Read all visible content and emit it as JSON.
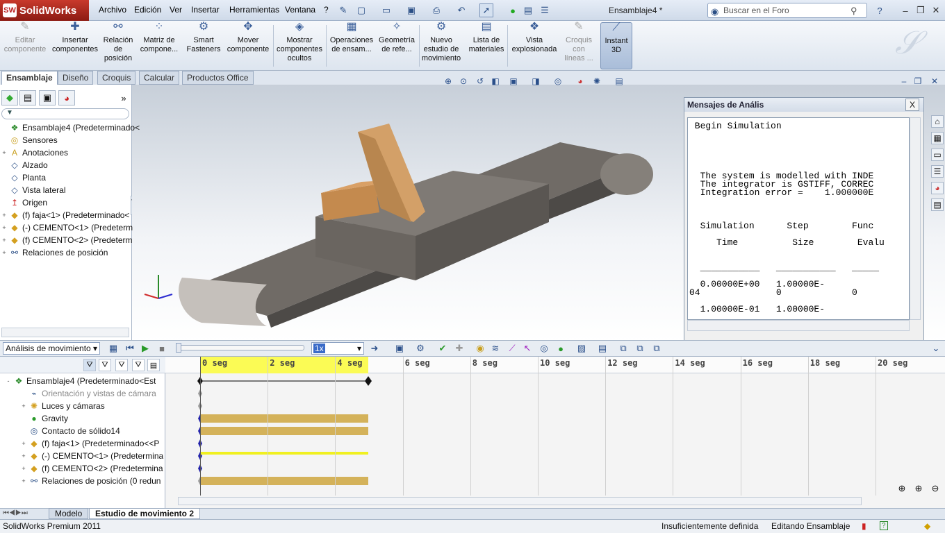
{
  "app": {
    "name": "SolidWorks",
    "doc_title": "Ensamblaje4 *"
  },
  "menu": [
    "Archivo",
    "Edición",
    "Ver",
    "Insertar",
    "Herramientas",
    "Ventana",
    "?"
  ],
  "search": {
    "placeholder": "Buscar en el Foro"
  },
  "ribbon": {
    "edit_component": "Editar componente",
    "insert_components": "Insertar componentes",
    "mate": "Relación de posición",
    "pattern": "Matriz de compone...",
    "smart_fasteners": "Smart Fasteners",
    "move_component": "Mover componente",
    "show_hidden": "Mostrar componentes ocultos",
    "assembly_features": "Operaciones de ensam...",
    "ref_geometry": "Geometría de refe...",
    "new_motion_study": "Nuevo estudio de movimiento",
    "bom": "Lista de materiales",
    "exploded_view": "Vista explosionada",
    "explode_line": "Croquis con líneas ...",
    "instant3d": "Instant 3D"
  },
  "cm_tabs": [
    "Ensamblaje",
    "Diseño",
    "Croquis",
    "Calcular",
    "Productos Office"
  ],
  "feature_tree": [
    {
      "label": "Ensamblaje4  (Predeterminado<",
      "icon": "assembly-icon",
      "exp": ""
    },
    {
      "label": "Sensores",
      "icon": "sensor-icon",
      "exp": ""
    },
    {
      "label": "Anotaciones",
      "icon": "annotation-icon",
      "exp": "+"
    },
    {
      "label": "Alzado",
      "icon": "plane-icon",
      "exp": ""
    },
    {
      "label": "Planta",
      "icon": "plane-icon",
      "exp": ""
    },
    {
      "label": "Vista lateral",
      "icon": "plane-icon",
      "exp": ""
    },
    {
      "label": "Origen",
      "icon": "origin-icon",
      "exp": ""
    },
    {
      "label": "(f) faja<1> (Predeterminado<",
      "icon": "part-icon",
      "exp": "+"
    },
    {
      "label": "(-) CEMENTO<1> (Predeterm",
      "icon": "part-icon",
      "exp": "+"
    },
    {
      "label": "(f) CEMENTO<2> (Predeterm",
      "icon": "part-icon",
      "exp": "+"
    },
    {
      "label": "Relaciones de posición",
      "icon": "mates-icon",
      "exp": "+"
    }
  ],
  "messages": {
    "title": "Mensajes de Anális",
    "lines": [
      " Begin Simulation",
      "",
      "",
      "",
      "",
      "",
      "  The system is modelled with INDE",
      "  The integrator is GSTIFF, CORREC",
      "  Integration error =    1.000000E",
      "",
      "",
      "",
      "  Simulation      Step        Func",
      "",
      "     Time          Size        Evalu",
      "",
      "",
      "  ___________   ___________   _____",
      "",
      "  0.00000E+00   1.00000E-",
      "04              0             0",
      "",
      "  1.00000E-01   1.00000E-"
    ]
  },
  "motion": {
    "study_type": "Análisis de movimiento",
    "speed": "1x",
    "ticks": [
      "0 seg",
      "2 seg",
      "4 seg",
      "6 seg",
      "8 seg",
      "10 seg",
      "12 seg",
      "14 seg",
      "16 seg",
      "18 seg",
      "20 seg"
    ],
    "tree": [
      {
        "label": "Ensamblaje4  (Predeterminado<Est",
        "icon": "assembly-icon",
        "exp": "-",
        "indent": 0,
        "grey": false
      },
      {
        "label": "Orientación y vistas de cámara",
        "icon": "camera-icon",
        "exp": "",
        "indent": 1,
        "grey": true
      },
      {
        "label": "Luces y cámaras",
        "icon": "lights-icon",
        "exp": "+",
        "indent": 1,
        "grey": false
      },
      {
        "label": "Gravity",
        "icon": "gravity-icon",
        "exp": "",
        "indent": 1,
        "grey": false
      },
      {
        "label": "Contacto de sólido14",
        "icon": "contact-icon",
        "exp": "",
        "indent": 1,
        "grey": false
      },
      {
        "label": "(f) faja<1> (Predeterminado<<P",
        "icon": "part-icon",
        "exp": "+",
        "indent": 1,
        "grey": false
      },
      {
        "label": "(-) CEMENTO<1> (Predetermina",
        "icon": "part-icon",
        "exp": "+",
        "indent": 1,
        "grey": false
      },
      {
        "label": "(f) CEMENTO<2> (Predetermina",
        "icon": "part-icon",
        "exp": "+",
        "indent": 1,
        "grey": false
      },
      {
        "label": "Relaciones de posición (0 redun",
        "icon": "mates-icon",
        "exp": "+",
        "indent": 1,
        "grey": false
      }
    ]
  },
  "bottom_tabs": [
    "Modelo",
    "Estudio de movimiento 2"
  ],
  "status": {
    "product": "SolidWorks Premium 2011",
    "definition": "Insuficientemente definida",
    "mode": "Editando Ensamblaje"
  },
  "colors": {
    "accent": "#2b4f86",
    "timeline_bar": "#d4b25a",
    "timeline_yellow": "#f0f020",
    "box": "#d9a066"
  }
}
